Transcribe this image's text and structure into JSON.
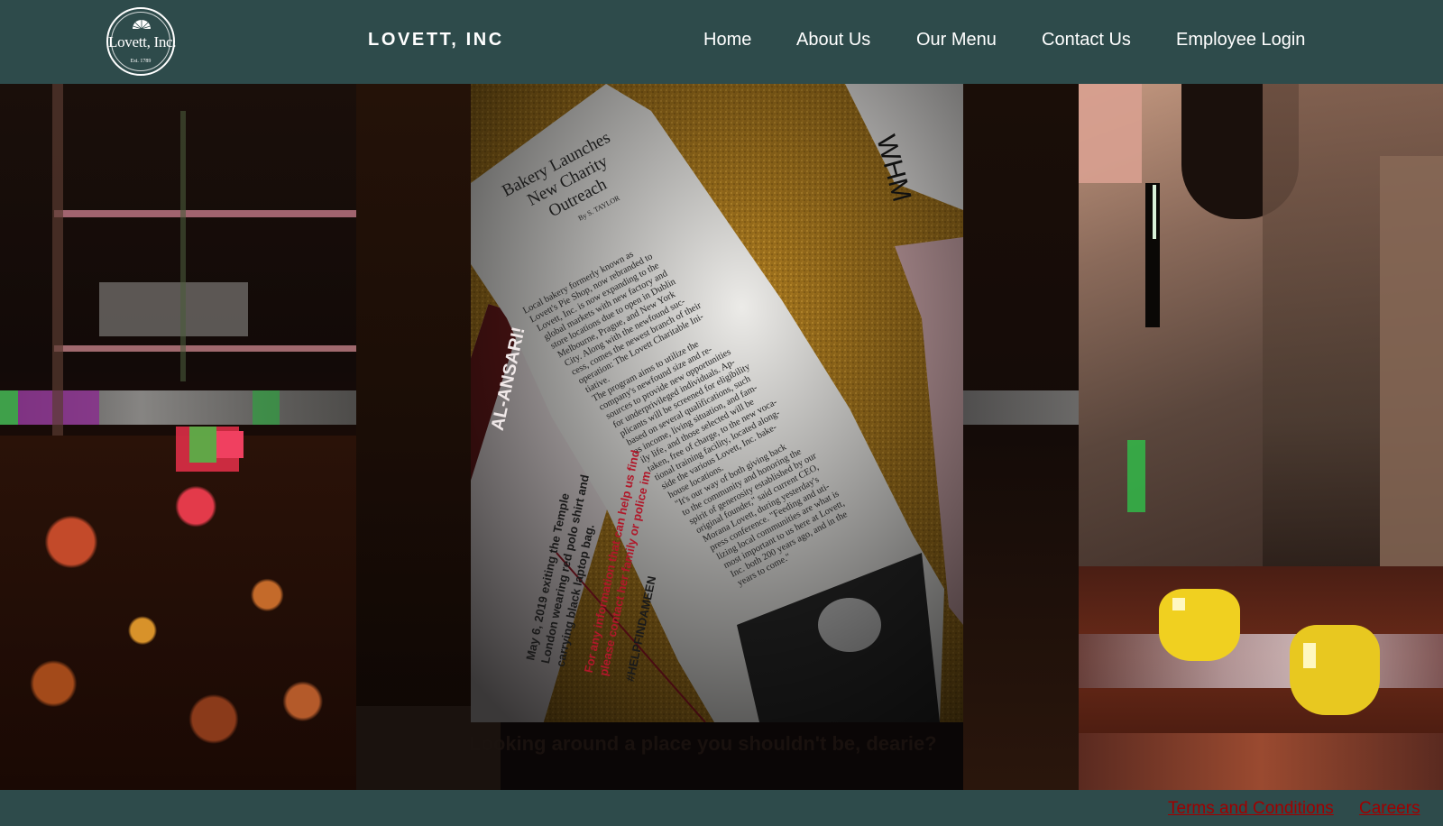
{
  "header": {
    "logo": {
      "name": "Lovett, Inc.",
      "est": "Est. 1789"
    },
    "brand": "LOVETT, INC",
    "nav": [
      {
        "label": "Home"
      },
      {
        "label": "About Us"
      },
      {
        "label": "Our Menu"
      },
      {
        "label": "Contact Us"
      },
      {
        "label": "Employee Login"
      }
    ]
  },
  "main": {
    "photo": {
      "clipping": {
        "headline_line1": "Bakery Launches",
        "headline_line2": "New Charity",
        "headline_line3": "Outreach",
        "byline": "By S. TAYLOR",
        "body": [
          "Local bakery formerly known as",
          "Lovett's Pie Shop, now rebranded to",
          "Lovett, Inc. is now expanding to the",
          "global markets with new factory and",
          "store locations due to open in Dublin",
          "Melbourne, Prague, and New York",
          "City. Along with the newfound suc-",
          "cess, comes the newest branch of their",
          "operation: The Lovett Charitable Ini-",
          "tiative.",
          "The program aims to utilize the",
          "company's newfound size and re-",
          "sources to provide new opportunities",
          "for underprivileged individuals. Ap-",
          "plicants will be screened for eligibility",
          "based on several qualifications, such",
          "as income, living situation, and fam-",
          "ily life, and those selected will be",
          "taken, free of charge, to the new voca-",
          "tional training facility, located along-",
          "side the various Lovett, Inc. bake-",
          "house locations.",
          "\"It's our way of both giving back",
          "to the community and honoring the",
          "spirit of generosity established by our",
          "original founder,\" said current CEO,",
          "Morana Lovett, during yesterday's",
          "press conference. \"Feeding and uti-",
          "lizing local communities are what is",
          "most important to us here at Lovett,",
          "Inc. both 200 years ago, and in the",
          "years to come.\""
        ]
      },
      "poster": {
        "name": "AL-ANSARI!",
        "line1": "May 6, 2019 exiting the Temple",
        "line2": "London wearing red polo shirt and",
        "line3": "carrying black laptop bag.",
        "line4": "For any information that can help us find",
        "line5": "please contact her family or police im",
        "hashtag": "#HELPFINDAMEEN"
      },
      "note": "WHM"
    },
    "tagline": "Looking around a place you shouldn't be, dearie?"
  },
  "footer": {
    "links": [
      {
        "label": "Terms and Conditions"
      },
      {
        "label": "Careers"
      }
    ]
  },
  "colors": {
    "header_bg": "#2e4b4b",
    "footer_bg": "#2e4b4b",
    "nav_text": "#ffffff",
    "footer_link": "#a00000"
  }
}
